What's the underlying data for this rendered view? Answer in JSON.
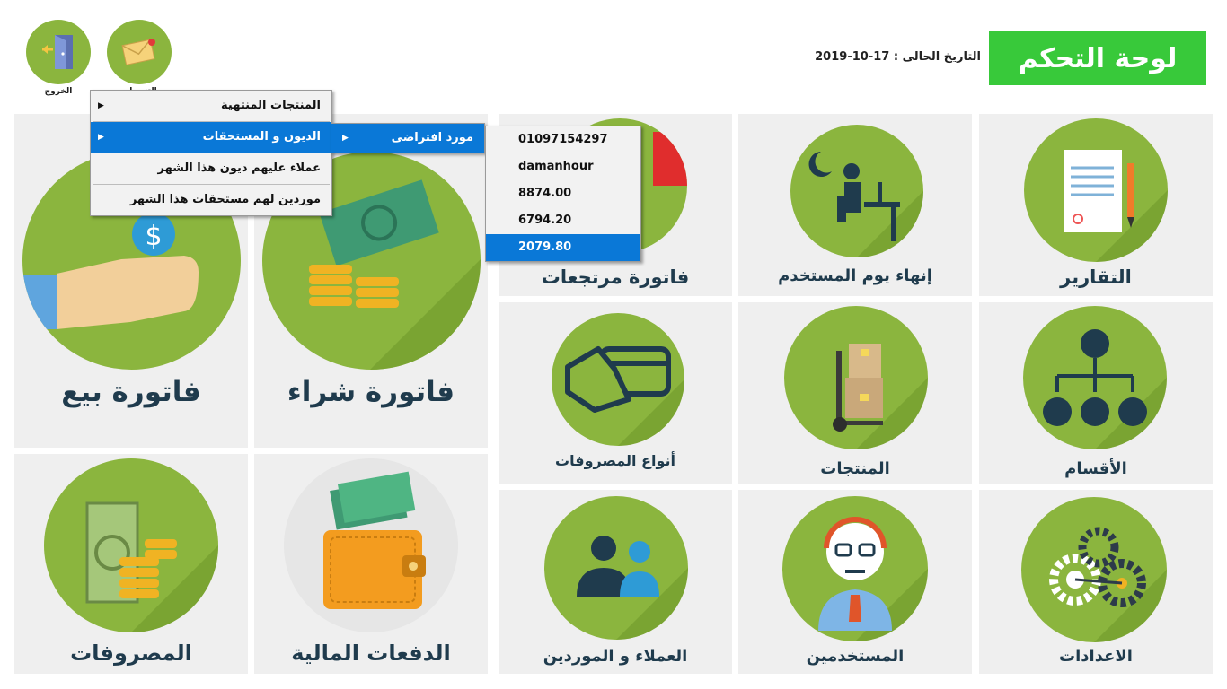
{
  "header": {
    "title": "لوحة التحكم",
    "date_label": "التاريخ الحالى :",
    "date_value": "17-10-2019"
  },
  "top_buttons": {
    "logout_label": "الخروج",
    "notifications_label": "التنبيهات"
  },
  "tiles": {
    "reports": "التقارير",
    "end_user_day": "إنهاء يوم المستخدم",
    "returns_invoice": "فاتورة مرتجعات",
    "categories": "الأقسام",
    "products": "المنتجات",
    "expense_types": "أنواع المصروفات",
    "settings": "الاعدادات",
    "users": "المستخدمين",
    "customers_suppliers": "العملاء و الموردين",
    "sales_invoice": "فاتورة بيع",
    "purchase_invoice": "فاتورة شراء",
    "expenses": "المصروفات",
    "payments": "الدفعات المالية"
  },
  "menu": {
    "items": [
      {
        "label": "المنتجات المنتهية",
        "has_submenu": true,
        "selected": false
      },
      {
        "label": "الديون و المستحقات",
        "has_submenu": true,
        "selected": true
      },
      {
        "label": "عملاء عليهم ديون هذا الشهر",
        "has_submenu": false,
        "selected": false
      },
      {
        "label": "موردين لهم مستحقات هذا الشهر",
        "has_submenu": false,
        "selected": false
      }
    ],
    "submenu_label": "مورد افتراضى",
    "details": [
      "01097154297",
      "damanhour",
      "8874.00",
      "6794.20",
      "2079.80"
    ]
  },
  "colors": {
    "accent_green": "#38c93a",
    "tile_circle": "#8bb53e",
    "menu_highlight": "#0a78d7"
  },
  "icons": {
    "logout": "door-exit-icon",
    "notifications": "envelope-icon"
  }
}
